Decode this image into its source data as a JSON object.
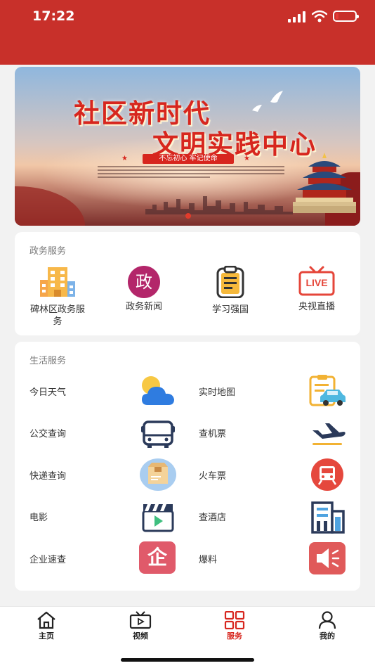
{
  "status": {
    "time": "17:22"
  },
  "banner": {
    "title_line1": "社区新时代",
    "title_line2": "文明实践中心",
    "slogan": "不忘初心  牢记使命"
  },
  "gov_section": {
    "title": "政务服务",
    "items": [
      {
        "label": "碑林区政务服务",
        "icon": "building-icon"
      },
      {
        "label": "政务新闻",
        "icon": "gov-news-icon",
        "glyph": "政"
      },
      {
        "label": "学习强国",
        "icon": "clipboard-icon"
      },
      {
        "label": "央视直播",
        "icon": "live-tv-icon",
        "glyph": "LIVE"
      }
    ]
  },
  "life_section": {
    "title": "生活服务",
    "items": [
      {
        "label": "今日天气",
        "icon": "weather-icon"
      },
      {
        "label": "实时地图",
        "icon": "map-car-icon"
      },
      {
        "label": "公交查询",
        "icon": "bus-icon"
      },
      {
        "label": "查机票",
        "icon": "airplane-icon"
      },
      {
        "label": "快递查询",
        "icon": "package-icon"
      },
      {
        "label": "火车票",
        "icon": "train-icon"
      },
      {
        "label": "电影",
        "icon": "clapperboard-icon"
      },
      {
        "label": "查酒店",
        "icon": "hotel-icon"
      },
      {
        "label": "企业速查",
        "icon": "enterprise-icon",
        "glyph": "企"
      },
      {
        "label": "爆料",
        "icon": "speaker-icon"
      }
    ]
  },
  "tabs": [
    {
      "label": "主页",
      "icon": "home-icon",
      "active": false
    },
    {
      "label": "视频",
      "icon": "tv-icon",
      "active": false
    },
    {
      "label": "服务",
      "icon": "grid-icon",
      "active": true
    },
    {
      "label": "我的",
      "icon": "user-icon",
      "active": false
    }
  ],
  "colors": {
    "brand": "#c8302a",
    "accent": "#d7261e"
  }
}
